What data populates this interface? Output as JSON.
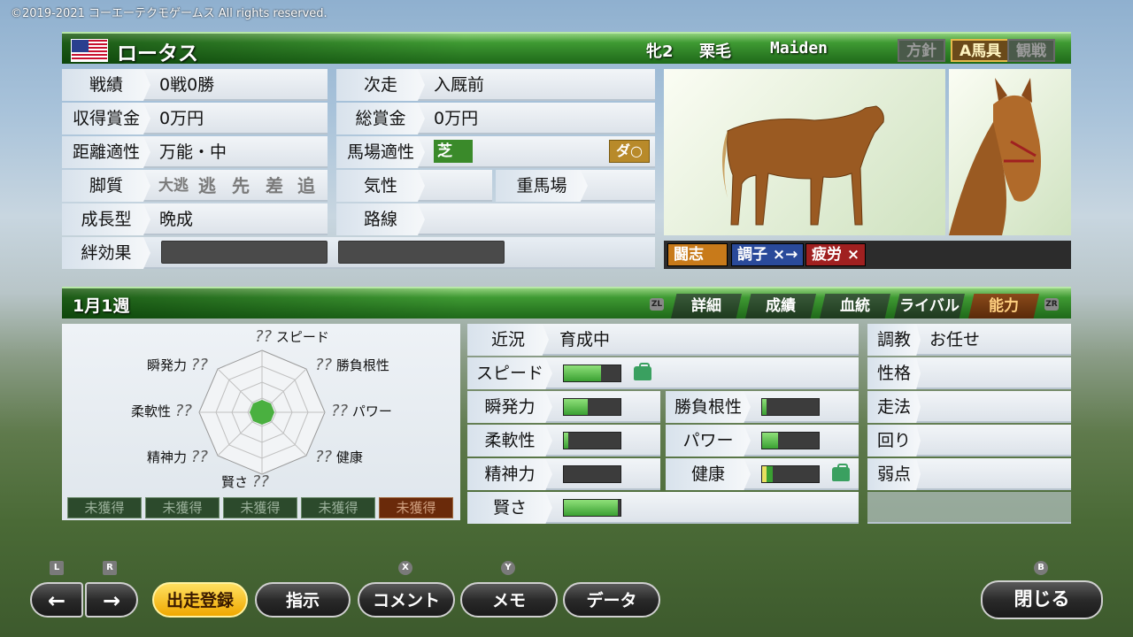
{
  "copyright": "©2019-2021 コーエーテクモゲームス All rights reserved.",
  "header": {
    "name": "ロータス",
    "sex_age": "牝2",
    "coat": "栗毛",
    "class": "Maiden",
    "buttons": [
      "方針",
      "A馬具",
      "観戦"
    ]
  },
  "info": {
    "record_label": "戦績",
    "record": "0戦0勝",
    "prize_label": "収得賞金",
    "prize": "0万円",
    "distance_label": "距離適性",
    "distance": "万能・中",
    "style_label": "脚質",
    "styles": [
      "大逃",
      "逃",
      "先",
      "差",
      "追"
    ],
    "growth_label": "成長型",
    "growth": "晩成",
    "bond_label": "絆効果",
    "next_label": "次走",
    "next": "入厩前",
    "total_prize_label": "総賞金",
    "total_prize": "0万円",
    "track_label": "馬場適性",
    "turf": "芝",
    "dirt": "ダ○",
    "temper_label": "気性",
    "heavy_label": "重馬場",
    "route_label": "路線"
  },
  "badges": [
    "闘志",
    "調子 ×→",
    "疲労 ×"
  ],
  "section": {
    "date": "1月1週",
    "tabs": [
      "詳細",
      "成績",
      "血統",
      "ライバル",
      "能力"
    ],
    "tab_left_key": "ZL",
    "tab_right_key": "ZR"
  },
  "radar": {
    "unknown": "??",
    "speed": "スピード",
    "stamina": "勝負根性",
    "power": "パワー",
    "health": "健康",
    "wisdom": "賢さ",
    "mental": "精神力",
    "flex": "柔軟性",
    "burst": "瞬発力",
    "unacquired": [
      "未獲得",
      "未獲得",
      "未獲得",
      "未獲得",
      "未獲得"
    ]
  },
  "stats": {
    "condition_label": "近況",
    "condition": "育成中",
    "speed": {
      "label": "スピード",
      "level": 0.65
    },
    "burst": {
      "label": "瞬発力",
      "level": 0.42
    },
    "guts": {
      "label": "勝負根性",
      "level": 0.08
    },
    "flex": {
      "label": "柔軟性",
      "level": 0.08
    },
    "power": {
      "label": "パワー",
      "level": 0.28
    },
    "mental": {
      "label": "精神力",
      "level": 0.0
    },
    "health": {
      "label": "健康",
      "level": 0.18
    },
    "wisdom": {
      "label": "賢さ",
      "level": 0.95
    }
  },
  "right": {
    "training_label": "調教",
    "training": "お任せ",
    "personality_label": "性格",
    "run_label": "走法",
    "turn_label": "回り",
    "weakness_label": "弱点"
  },
  "bottom": {
    "key_l": "L",
    "key_r": "R",
    "key_x": "X",
    "key_y": "Y",
    "key_b": "B",
    "prev": "←",
    "next": "→",
    "entry": "出走登録",
    "instruct": "指示",
    "comment": "コメント",
    "memo": "メモ",
    "data": "データ",
    "close": "閉じる"
  },
  "colors": {
    "accent_green": "#2c7d24",
    "active_tab": "#8a4a1a",
    "entry_yellow": "#f0a800"
  }
}
